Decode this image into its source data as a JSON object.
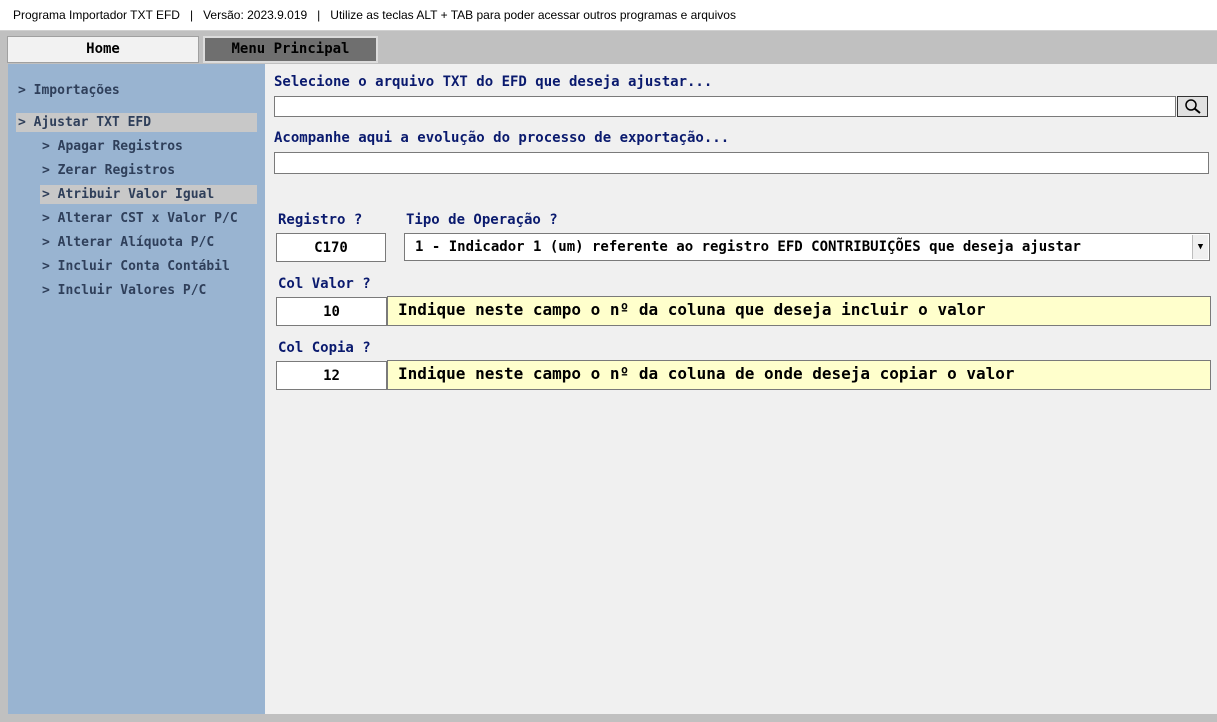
{
  "titlebar": {
    "app": "Programa Importador TXT EFD",
    "sep": "|",
    "version": "Versão: 2023.9.019",
    "hint": "Utilize as teclas ALT + TAB para poder acessar outros programas e arquivos"
  },
  "tabs": {
    "home": "Home",
    "menu": "Menu Principal"
  },
  "sidebar": {
    "items": [
      "> Importações",
      "> Ajustar TXT EFD",
      "> Apagar Registros",
      "> Zerar Registros",
      "> Atribuir Valor Igual",
      "> Alterar CST x Valor P/C",
      "> Alterar Alíquota P/C",
      "> Incluir Conta Contábil",
      "> Incluir Valores P/C"
    ]
  },
  "main": {
    "file_label": "Selecione o arquivo TXT do EFD que deseja ajustar...",
    "file_value": "",
    "progress_label": "Acompanhe aqui a evolução do processo de exportação...",
    "progress_value": "",
    "registro_label": "Registro ?",
    "registro_value": "C170",
    "tipo_label": "Tipo de Operação ?",
    "tipo_value": "1 - Indicador 1 (um) referente ao registro EFD CONTRIBUIÇÕES que deseja ajustar",
    "col_valor_label": "Col Valor ?",
    "col_valor_value": "10",
    "col_valor_hint": "Indique neste campo o nº da coluna que deseja incluir o valor",
    "col_copia_label": "Col Copia ?",
    "col_copia_value": "12",
    "col_copia_hint": "Indique neste campo o nº da coluna de onde deseja copiar o valor"
  },
  "icons": {
    "browse": "magnifier-icon",
    "dropdown": "chevron-down-icon"
  },
  "colors": {
    "sidebar": "#99b4d1",
    "hint_bg": "#ffffcc",
    "label": "#0a1a6e"
  }
}
